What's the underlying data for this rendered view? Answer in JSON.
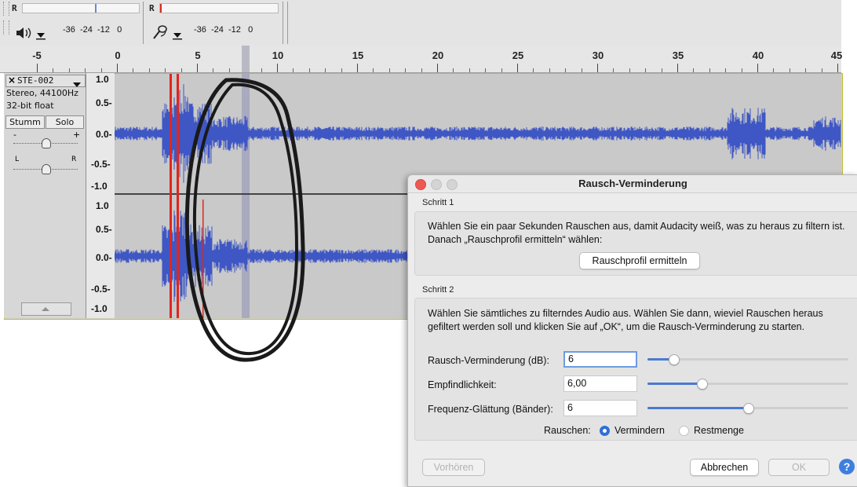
{
  "meters": {
    "playback_channel": "R",
    "record_channel": "R",
    "playback_scale": "-36  -24  -12   0",
    "record_scale": "-36  -24  -12   0",
    "speaker_icon": "speaker-icon",
    "mic_icon": "microphone-icon"
  },
  "ruler": {
    "labels": [
      "-5",
      "0",
      "5",
      "10",
      "15",
      "20",
      "25",
      "30",
      "35",
      "40",
      "45"
    ]
  },
  "track": {
    "name": "STE-002",
    "format_line1": "Stereo, 44100Hz",
    "format_line2": "32-bit float",
    "mute_label": "Stumm",
    "solo_label": "Solo",
    "gain_minus": "-",
    "gain_plus": "+",
    "pan_left": "L",
    "pan_right": "R",
    "scale_top": [
      "1.0",
      "0.5-",
      "0.0-",
      "-0.5-",
      "-1.0"
    ],
    "scale_bottom": [
      "1.0",
      "0.5-",
      "0.0-",
      "-0.5-",
      "-1.0"
    ]
  },
  "dialog": {
    "title": "Rausch-Verminderung",
    "step1_label": "Schritt 1",
    "step1_text_line1": "Wählen Sie ein paar Sekunden Rauschen aus, damit Audacity weiß, was zu heraus zu filtern ist.",
    "step1_text_line2": "Danach „Rauschprofil ermitteln“ wählen:",
    "profile_button": "Rauschprofil ermitteln",
    "step2_label": "Schritt 2",
    "step2_text_line1": "Wählen Sie sämtliches zu filterndes Audio aus. Wählen Sie dann, wieviel Rauschen heraus",
    "step2_text_line2": "gefiltert werden soll und klicken Sie auf „OK“, um die Rausch-Verminderung zu starten.",
    "fields": [
      {
        "label": "Rausch-Verminderung (dB):",
        "value": "6",
        "slider_level": 0.13
      },
      {
        "label": "Empfindlichkeit:",
        "value": "6,00",
        "slider_level": 0.27
      },
      {
        "label": "Frequenz-Glättung (Bänder):",
        "value": "6",
        "slider_level": 0.5
      }
    ],
    "noise_label": "Rauschen:",
    "option_reduce": "Vermindern",
    "option_residue": "Restmenge",
    "preview_button": "Vorhören",
    "cancel_button": "Abbrechen",
    "ok_button": "OK",
    "help_glyph": "?"
  },
  "colors": {
    "waveform": "#3f57c4",
    "selection_line": "#e0261e",
    "annotation_ink": "#1a1a1a",
    "accent": "#2f6fd7"
  }
}
